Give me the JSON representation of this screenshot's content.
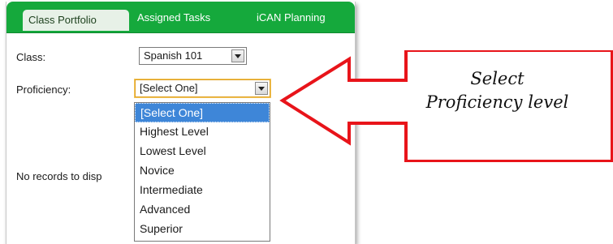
{
  "tabs": [
    {
      "label": "Class Portfolio",
      "active": true
    },
    {
      "label": "Assigned Tasks",
      "active": false
    },
    {
      "label": "iCAN Planning",
      "active": false
    }
  ],
  "form": {
    "class_label": "Class:",
    "class_value": "Spanish 101",
    "proficiency_label": "Proficiency:",
    "proficiency_value": "[Select One]"
  },
  "dropdown": {
    "options": [
      "[Select One]",
      "Highest Level",
      "Lowest Level",
      "Novice",
      "Intermediate",
      "Advanced",
      "Superior"
    ],
    "highlighted": "[Select One]"
  },
  "empty_message": "No records to disp",
  "callout": {
    "line1": "Select",
    "line2": "Proficiency level",
    "arrow_color": "#e8141a"
  },
  "colors": {
    "tab_bar": "#15a93c",
    "selected_option": "#3e86d8"
  }
}
